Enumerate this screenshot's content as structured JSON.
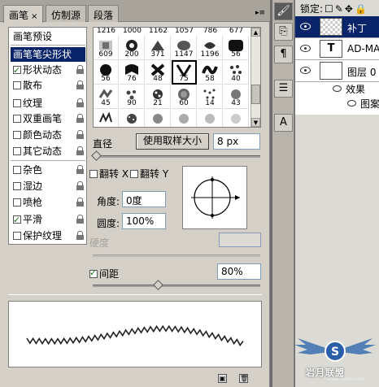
{
  "tabs": [
    {
      "label": "画笔",
      "close": "×"
    },
    {
      "label": "仿制源"
    },
    {
      "label": "段落"
    }
  ],
  "panel_menu_icon": "panel-menu-icon",
  "brush_list": {
    "preset_label": "画笔预设",
    "items": [
      {
        "label": "画笔笔尖形状",
        "selected": true
      },
      {
        "label": "形状动态",
        "checked": true
      },
      {
        "label": "散布",
        "checked": false
      },
      {
        "label": "纹理",
        "checked": false
      },
      {
        "label": "双重画笔",
        "checked": false
      },
      {
        "label": "颜色动态",
        "checked": false
      },
      {
        "label": "其它动态",
        "checked": false
      },
      {
        "label": "杂色",
        "checked": false
      },
      {
        "label": "湿边",
        "checked": false
      },
      {
        "label": "喷枪",
        "checked": false
      },
      {
        "label": "平滑",
        "checked": true
      },
      {
        "label": "保护纹理",
        "checked": false
      }
    ]
  },
  "tip_grid": {
    "top_numbers": [
      "1216",
      "1000",
      "1162",
      "1057",
      "786",
      "677"
    ],
    "rows": [
      [
        "609",
        "200",
        "371",
        "1147",
        "1196",
        "56"
      ],
      [
        "56",
        "76",
        "48",
        "75",
        "58",
        "40"
      ],
      [
        "45",
        "90",
        "21",
        "60",
        "14",
        "43"
      ],
      [
        "",
        "",
        "",
        "",
        "",
        ""
      ]
    ]
  },
  "diameter": {
    "label": "直径",
    "button": "使用取样大小",
    "value": "8 px",
    "slider_fraction": 0.02
  },
  "flip": {
    "x_label": "翻转 X",
    "y_label": "翻转 Y"
  },
  "angle": {
    "label": "角度:",
    "value": "0度"
  },
  "roundness": {
    "label": "圆度:",
    "value": "100%"
  },
  "hardness": {
    "label": "硬度",
    "value": ""
  },
  "spacing": {
    "label": "间距",
    "checked": true,
    "value": "80%",
    "slider_fraction": 0.4
  },
  "strip_icons": [
    "brush-panel-icon",
    "clone-source-icon",
    "paragraph-icon",
    "character-panel-icon",
    "text-icon"
  ],
  "layers": {
    "lock_label": "锁定:",
    "rows": [
      {
        "name": "补丁",
        "thumb": "checker",
        "selected": true
      },
      {
        "name": "AD-MAG",
        "thumb": "T",
        "selected": false
      },
      {
        "name": "图层 0",
        "thumb": "blank",
        "selected": false
      }
    ],
    "effects_label": "效果",
    "pattern_label": "图案"
  },
  "watermark": {
    "text": "岩月联盟",
    "sub": "www.5yue.com"
  }
}
